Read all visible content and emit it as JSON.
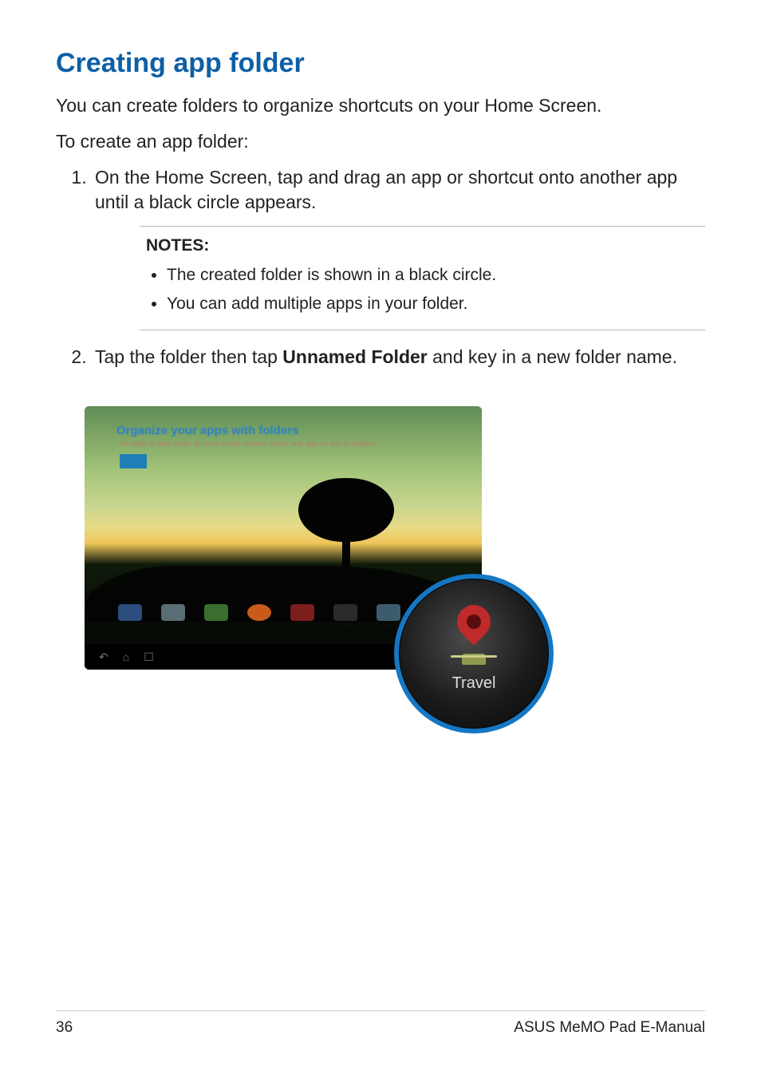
{
  "page": {
    "heading": "Creating app folder",
    "intro1": "You can create folders to organize shortcuts on your Home Screen.",
    "intro2": "To create an app folder:",
    "step1": "On the Home Screen, tap and drag an app or shortcut onto another app until a black circle appears.",
    "step2_pre": "Tap the folder then tap ",
    "step2_bold": "Unnamed Folder",
    "step2_post": " and key in a new folder name.",
    "notes_label": "NOTES:",
    "note1": "The created folder is shown in a black circle.",
    "note2": "You can add multiple apps in your folder."
  },
  "screenshot": {
    "tip_title": "Organize your apps with folders",
    "tip_sub": "To make a new folder on your Home screen, stack one app on top of another.",
    "folder_label": "Travel"
  },
  "footer": {
    "page_number": "36",
    "doc_title": "ASUS MeMO Pad E-Manual"
  }
}
